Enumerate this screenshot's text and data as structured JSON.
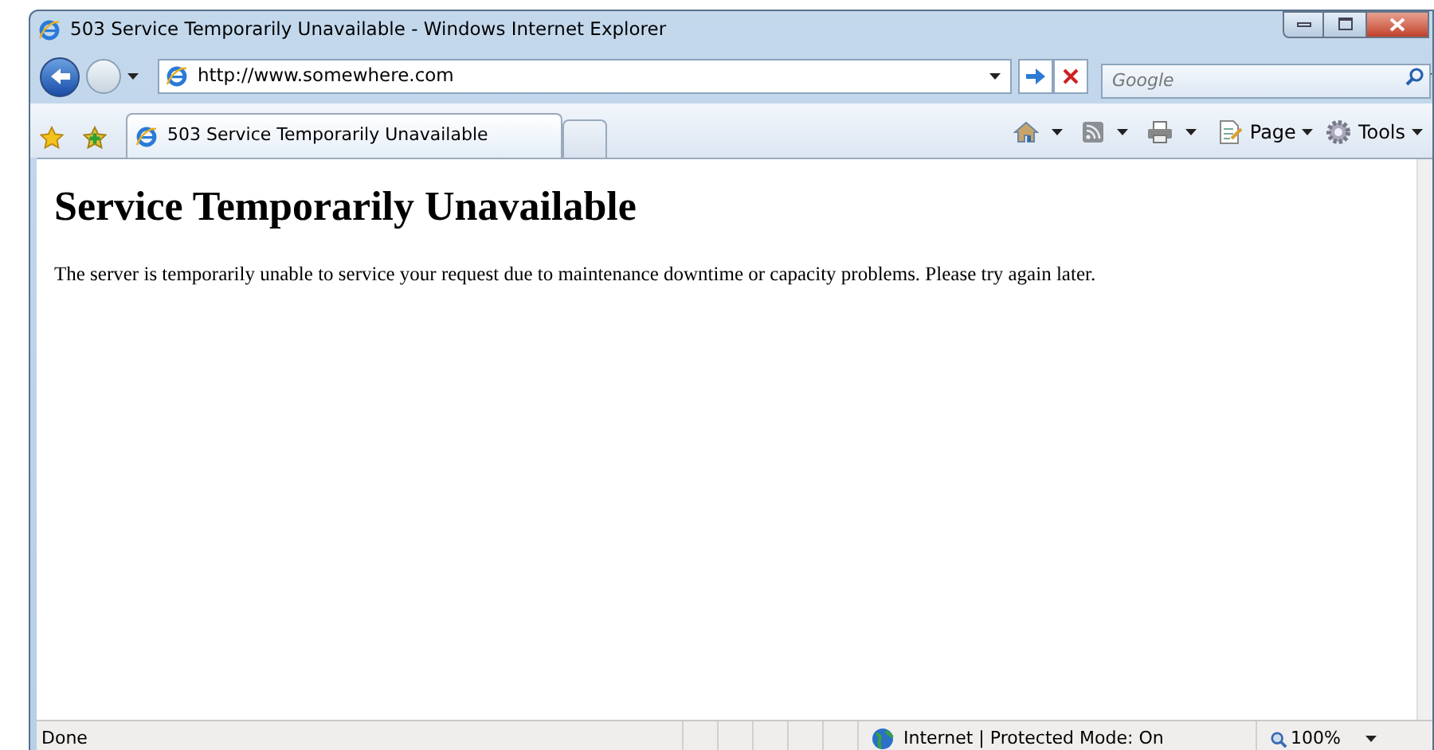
{
  "window": {
    "title": "503 Service Temporarily Unavailable - Windows Internet Explorer"
  },
  "address_bar": {
    "url": "http://www.somewhere.com"
  },
  "search": {
    "placeholder": "Google"
  },
  "tabs": [
    {
      "label": "503 Service Temporarily Unavailable",
      "selected": true
    }
  ],
  "command_bar": [
    {
      "kind": "home"
    },
    {
      "kind": "feeds"
    },
    {
      "kind": "print"
    },
    {
      "kind": "page",
      "label": "Page"
    },
    {
      "kind": "tools",
      "label": "Tools"
    }
  ],
  "page": {
    "heading": "Service Temporarily Unavailable",
    "message": "The server is temporarily unable to service your request due to maintenance downtime or capacity problems. Please try again later."
  },
  "status_bar": {
    "status": "Done",
    "zone": "Internet | Protected Mode: On",
    "zoom": "100%"
  }
}
